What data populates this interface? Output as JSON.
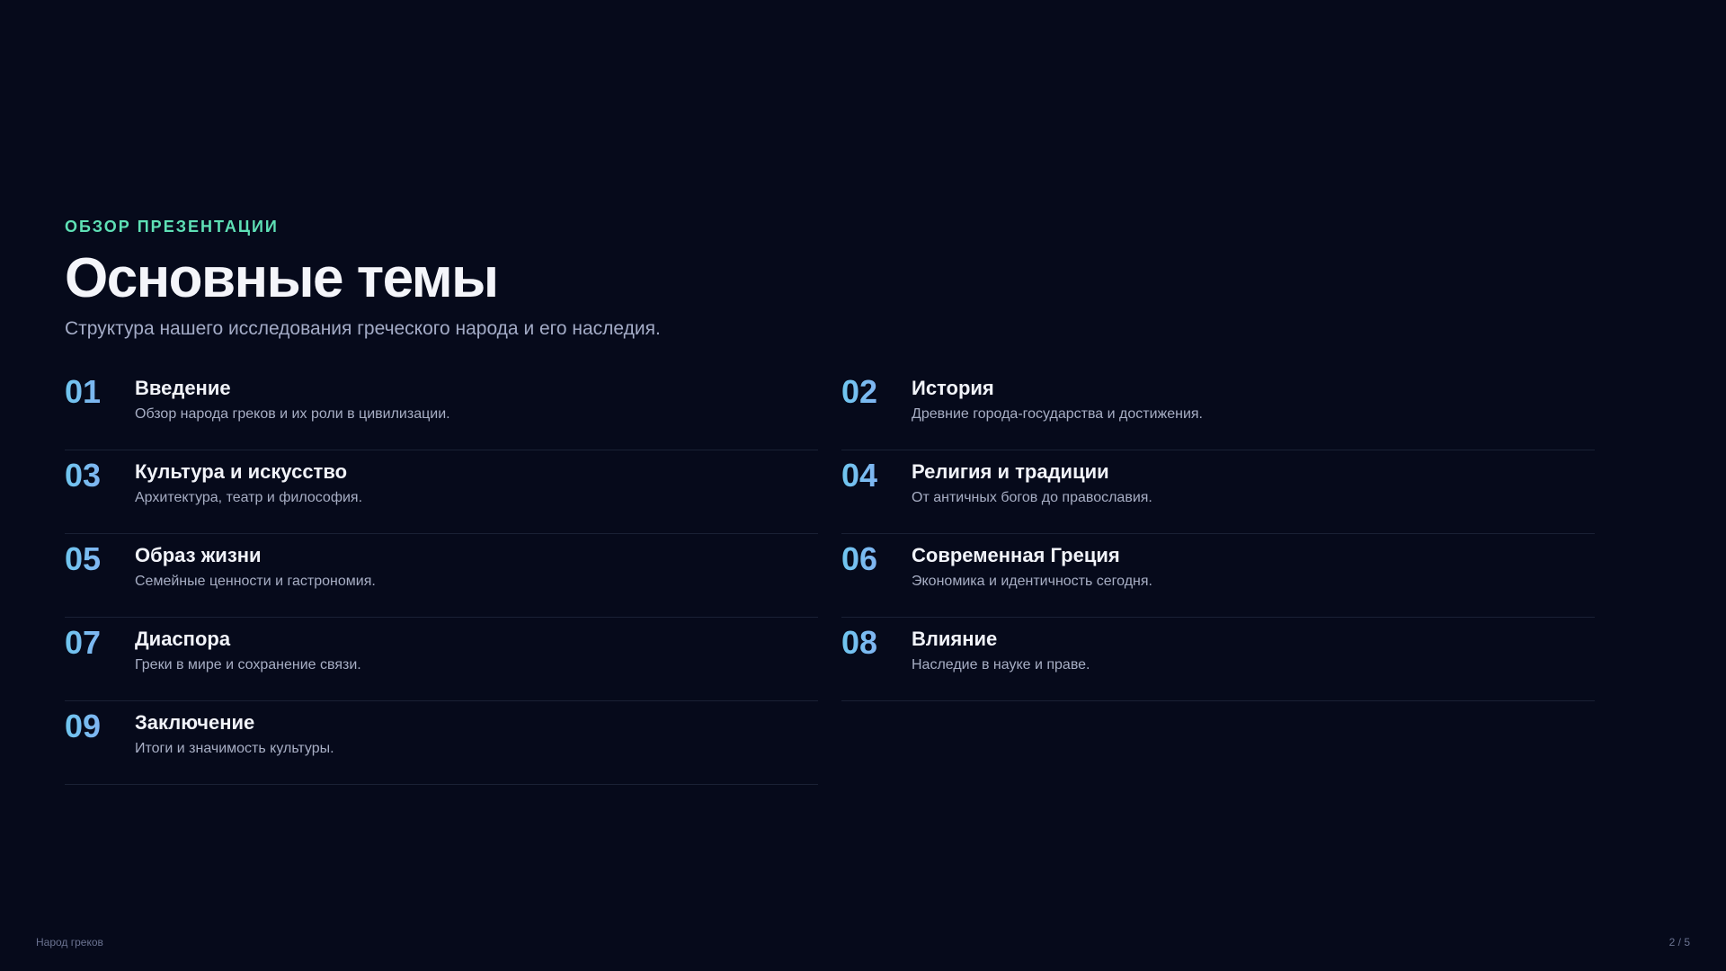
{
  "header": {
    "eyebrow": "ОБЗОР ПРЕЗЕНТАЦИИ",
    "title": "Основные темы",
    "subtitle": "Структура нашего исследования греческого народа и его наследия."
  },
  "topics": [
    {
      "num": "01",
      "title": "Введение",
      "desc": "Обзор народа греков и их роли в цивилизации."
    },
    {
      "num": "02",
      "title": "История",
      "desc": "Древние города-государства и достижения."
    },
    {
      "num": "03",
      "title": "Культура и искусство",
      "desc": "Архитектура, театр и философия."
    },
    {
      "num": "04",
      "title": "Религия и традиции",
      "desc": "От античных богов до православия."
    },
    {
      "num": "05",
      "title": "Образ жизни",
      "desc": "Семейные ценности и гастрономия."
    },
    {
      "num": "06",
      "title": "Современная Греция",
      "desc": "Экономика и идентичность сегодня."
    },
    {
      "num": "07",
      "title": "Диаспора",
      "desc": "Греки в мире и сохранение связи."
    },
    {
      "num": "08",
      "title": "Влияние",
      "desc": "Наследие в науке и праве."
    },
    {
      "num": "09",
      "title": "Заключение",
      "desc": "Итоги и значимость культуры."
    }
  ],
  "footer": {
    "deck_name": "Народ греков",
    "page_indicator": "2 / 5"
  },
  "colors": {
    "background": "#060a1b",
    "accent_eyebrow": "#5ee0b5",
    "number_gradient_start": "#6fc6ef",
    "number_gradient_end": "#8fa4f4"
  }
}
